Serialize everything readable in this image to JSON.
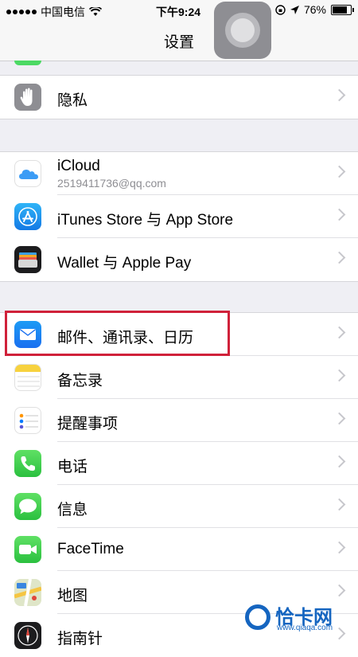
{
  "status_bar": {
    "carrier": "中国电信",
    "time": "下午9:24",
    "battery": "76%"
  },
  "nav": {
    "title": "设置"
  },
  "groups": [
    {
      "items": [
        {
          "label": "隐私",
          "icon": "hand-icon"
        }
      ]
    },
    {
      "items": [
        {
          "label": "iCloud",
          "sublabel": "2519411736@qq.com",
          "icon": "cloud-icon"
        },
        {
          "label": "iTunes Store 与 App Store",
          "icon": "app-store-icon"
        },
        {
          "label": "Wallet 与 Apple Pay",
          "icon": "wallet-icon"
        }
      ]
    },
    {
      "items": [
        {
          "label": "邮件、通讯录、日历",
          "icon": "mail-icon"
        },
        {
          "label": "备忘录",
          "icon": "notes-icon"
        },
        {
          "label": "提醒事项",
          "icon": "reminders-icon"
        },
        {
          "label": "电话",
          "icon": "phone-icon"
        },
        {
          "label": "信息",
          "icon": "messages-icon"
        },
        {
          "label": "FaceTime",
          "icon": "facetime-icon"
        },
        {
          "label": "地图",
          "icon": "maps-icon"
        },
        {
          "label": "指南针",
          "icon": "compass-icon"
        }
      ]
    }
  ],
  "watermark": {
    "brand": "恰卡网",
    "url": "www.qiaqa.com"
  },
  "colors": {
    "highlight": "#d0213a",
    "accent": "#007aff"
  }
}
